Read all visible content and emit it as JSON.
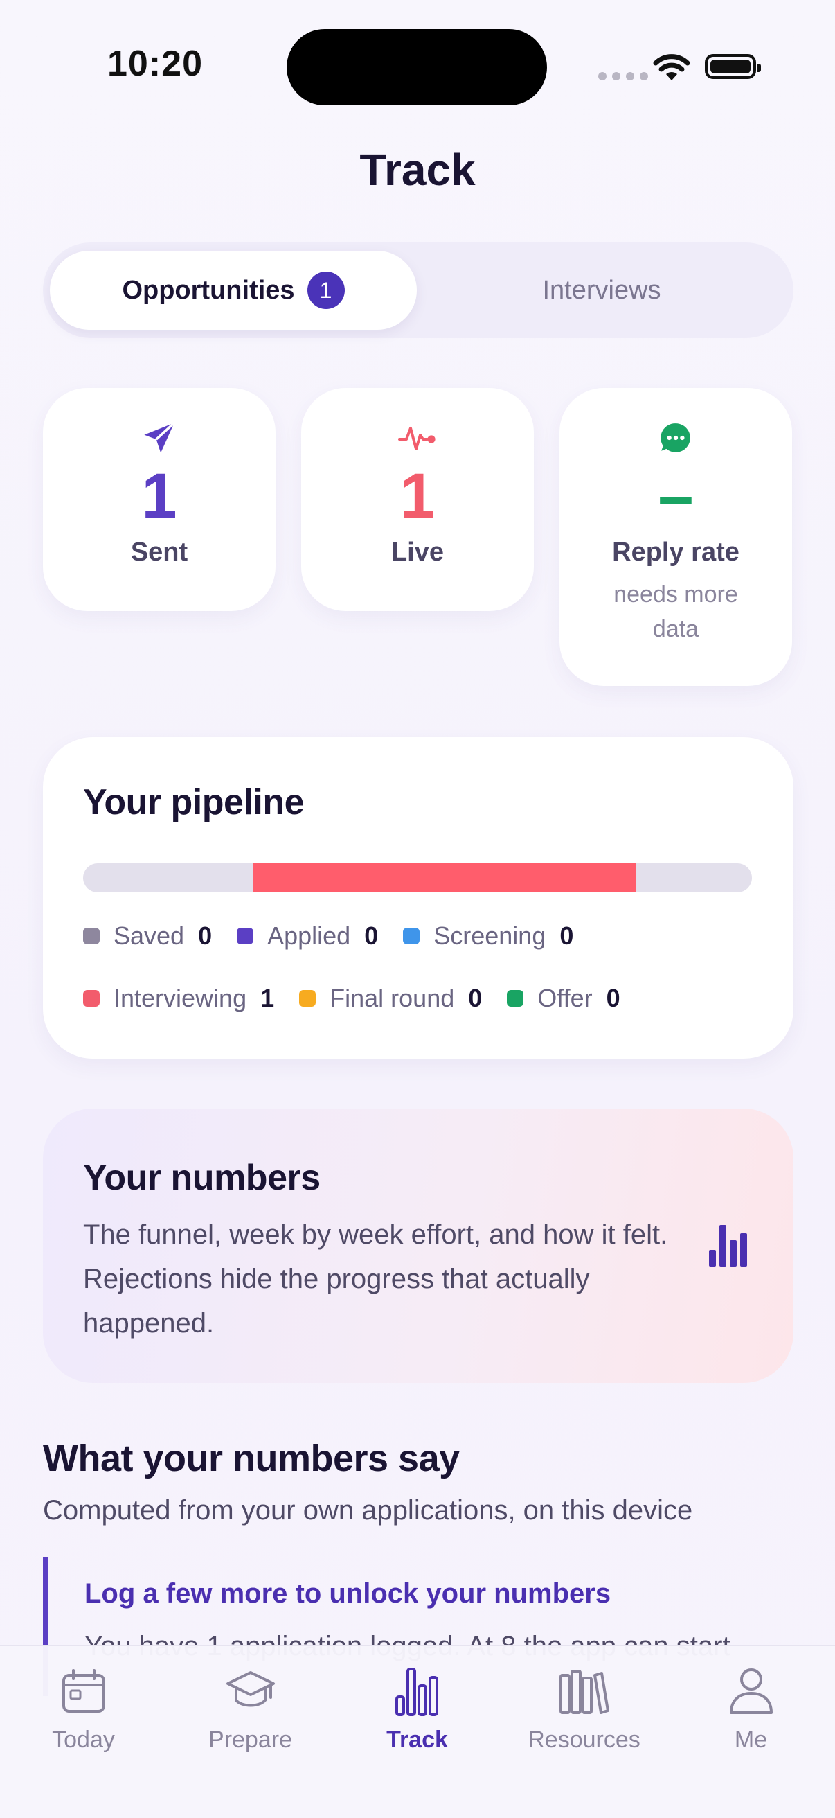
{
  "status_bar": {
    "time": "10:20"
  },
  "header": {
    "title": "Track"
  },
  "segmented": {
    "tabs": [
      {
        "label": "Opportunities",
        "badge": "1",
        "active": true
      },
      {
        "label": "Interviews",
        "active": false
      }
    ]
  },
  "stats": [
    {
      "icon": "paper-plane-icon",
      "value": "1",
      "label": "Sent",
      "color": "#5b3fc4"
    },
    {
      "icon": "pulse-icon",
      "value": "1",
      "label": "Live",
      "color": "#f25c6c"
    },
    {
      "icon": "chat-bubble-icon",
      "value": "–",
      "label": "Reply rate",
      "sub": "needs more data",
      "color": "#19a463"
    }
  ],
  "pipeline": {
    "title": "Your pipeline",
    "segment": {
      "stage": "Interviewing",
      "start_fraction": 0.255,
      "end_fraction": 0.826,
      "color": "#ff5d6c"
    },
    "legend": [
      {
        "label": "Saved",
        "count": "0",
        "color": "#8e879e"
      },
      {
        "label": "Applied",
        "count": "0",
        "color": "#5b3fc4"
      },
      {
        "label": "Screening",
        "count": "0",
        "color": "#3f95ea"
      },
      {
        "label": "Interviewing",
        "count": "1",
        "color": "#f25c6c"
      },
      {
        "label": "Final round",
        "count": "0",
        "color": "#f7ab20"
      },
      {
        "label": "Offer",
        "count": "0",
        "color": "#19a463"
      }
    ]
  },
  "numbers_card": {
    "title": "Your numbers",
    "body": "The funnel, week by week effort, and how it felt. Rejections hide the progress that actually happened.",
    "icon": "bar-chart-icon"
  },
  "insights": {
    "title": "What your numbers say",
    "subtitle": "Computed from your own applications, on this device",
    "callout_title": "Log a few more to unlock your numbers",
    "callout_body": "You have 1 application logged. At 8 the app can start"
  },
  "tabbar": {
    "items": [
      {
        "label": "Today",
        "icon": "calendar-icon",
        "active": false
      },
      {
        "label": "Prepare",
        "icon": "graduation-cap-icon",
        "active": false
      },
      {
        "label": "Track",
        "icon": "bar-chart-icon",
        "active": true
      },
      {
        "label": "Resources",
        "icon": "books-icon",
        "active": false
      },
      {
        "label": "Me",
        "icon": "person-icon",
        "active": false
      }
    ]
  },
  "colors": {
    "accent": "#4a2fb0",
    "live": "#f25c6c",
    "success": "#19a463"
  }
}
